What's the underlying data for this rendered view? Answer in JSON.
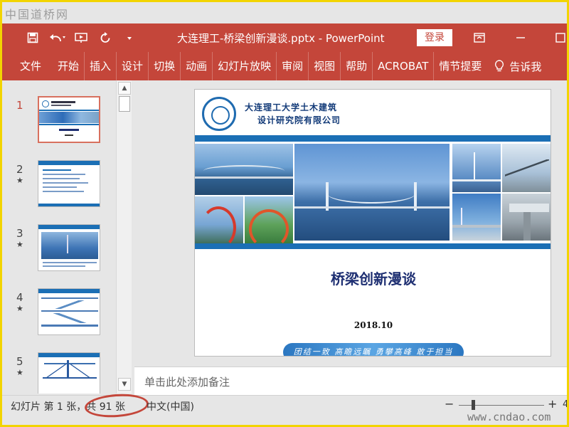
{
  "watermark_top": "中国道桥网",
  "watermark_bottom": "www.cndao.com",
  "window": {
    "title": "大连理工-桥梁创新漫谈.pptx  -  PowerPoint",
    "signin_label": "登录"
  },
  "ribbon": {
    "tabs": [
      "文件",
      "开始",
      "插入",
      "设计",
      "切换",
      "动画",
      "幻灯片放映",
      "审阅",
      "视图",
      "帮助",
      "ACROBAT",
      "情节提要"
    ],
    "tell_me": "告诉我"
  },
  "thumbnails": [
    {
      "number": "1",
      "star": ""
    },
    {
      "number": "2",
      "star": "★"
    },
    {
      "number": "3",
      "star": "★"
    },
    {
      "number": "4",
      "star": "★"
    },
    {
      "number": "5",
      "star": "★"
    }
  ],
  "slide": {
    "institution_line1": "大连理工大学土木建筑",
    "institution_line2": "设计研究院有限公司",
    "title": "桥梁创新漫谈",
    "date": "2018.10",
    "slogan": "团结一致  高瞻远瞩  勇攀高峰  敢于担当"
  },
  "notes_placeholder": "单击此处添加备注",
  "status": {
    "slide_count": "幻灯片 第 1 张，共 91 张",
    "language": "中文(中国)",
    "zoom_minus": "−",
    "zoom_plus": "+",
    "zoom_level": "4"
  },
  "colors": {
    "ribbon": "#c4463a",
    "accent_blue": "#1b6fb5",
    "highlight_ring": "#c4463a"
  }
}
